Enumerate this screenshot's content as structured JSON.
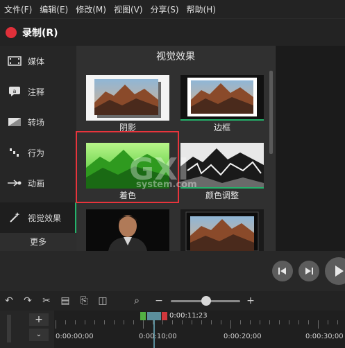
{
  "menu": [
    "文件(F)",
    "编辑(E)",
    "修改(M)",
    "视图(V)",
    "分享(S)",
    "帮助(H)"
  ],
  "record": {
    "label": "录制(R)",
    "color": "#e0303a"
  },
  "sidebar": {
    "items": [
      {
        "label": "媒体",
        "icon": "film-icon"
      },
      {
        "label": "注释",
        "icon": "annotation-icon"
      },
      {
        "label": "转场",
        "icon": "transition-icon"
      },
      {
        "label": "行为",
        "icon": "behavior-icon"
      },
      {
        "label": "动画",
        "icon": "animation-icon"
      },
      {
        "label": "视觉效果",
        "icon": "magic-wand-icon",
        "active": true
      }
    ],
    "more": "更多"
  },
  "panel": {
    "title": "视觉效果",
    "effects": [
      {
        "label": "阴影"
      },
      {
        "label": "边框"
      },
      {
        "label": "着色"
      },
      {
        "label": "颜色调整"
      },
      {
        "label": ""
      },
      {
        "label": ""
      }
    ]
  },
  "watermark": "system.com",
  "timeline": {
    "playhead_time": "0:00:11;23",
    "timecodes": [
      "0:00:00;00",
      "0:00:10;00",
      "0:00:20;00",
      "0:00:30;00"
    ]
  },
  "colors": {
    "accent": "#24b36b",
    "highlight": "#e8343c"
  }
}
